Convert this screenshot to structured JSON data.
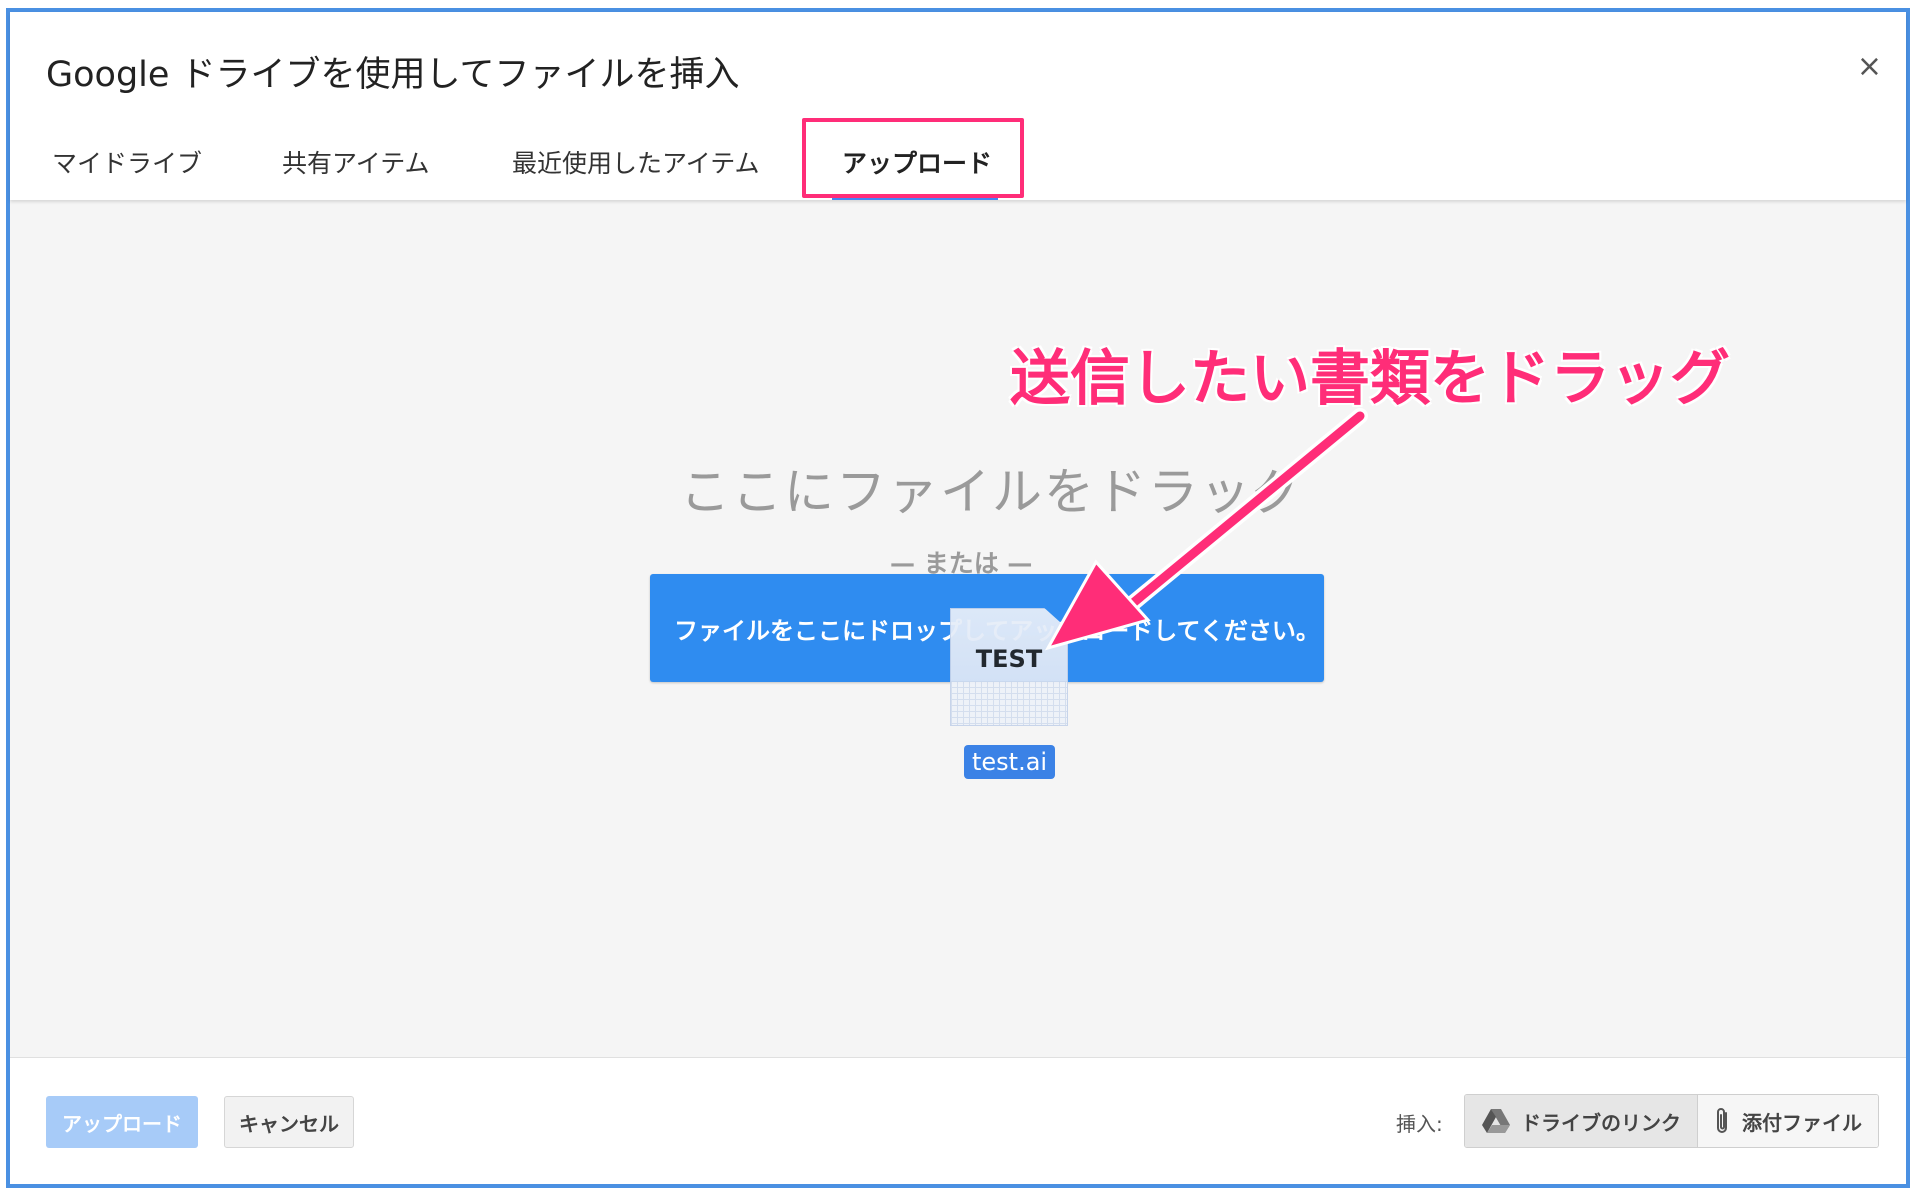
{
  "dialog": {
    "title": "Google ドライブを使用してファイルを挿入",
    "close_label": "×"
  },
  "tabs": [
    {
      "label": "マイドライブ",
      "active": false
    },
    {
      "label": "共有アイテム",
      "active": false
    },
    {
      "label": "最近使用したアイテム",
      "active": false
    },
    {
      "label": "アップロード",
      "active": true
    }
  ],
  "upload_area": {
    "drop_hint": "ここにファイルをドラッグ",
    "or_text": "— または —",
    "drop_button_label": "ファイルをここにドロップしてアップロードしてください。",
    "dragged_file_icon_text": "TEST",
    "dragged_file_name": "test.ai"
  },
  "annotation": {
    "text": "送信したい書類をドラッグ",
    "color": "#ff2d78"
  },
  "footer": {
    "upload_button": "アップロード",
    "cancel_button": "キャンセル",
    "insert_label": "挿入:",
    "insert_options": [
      {
        "label": "ドライブのリンク",
        "icon": "drive-icon",
        "selected": true
      },
      {
        "label": "添付ファイル",
        "icon": "paperclip-icon",
        "selected": false
      }
    ]
  },
  "colors": {
    "accent": "#4285f4",
    "drop_button": "#2f8cf0",
    "highlight": "#ff2d78"
  }
}
